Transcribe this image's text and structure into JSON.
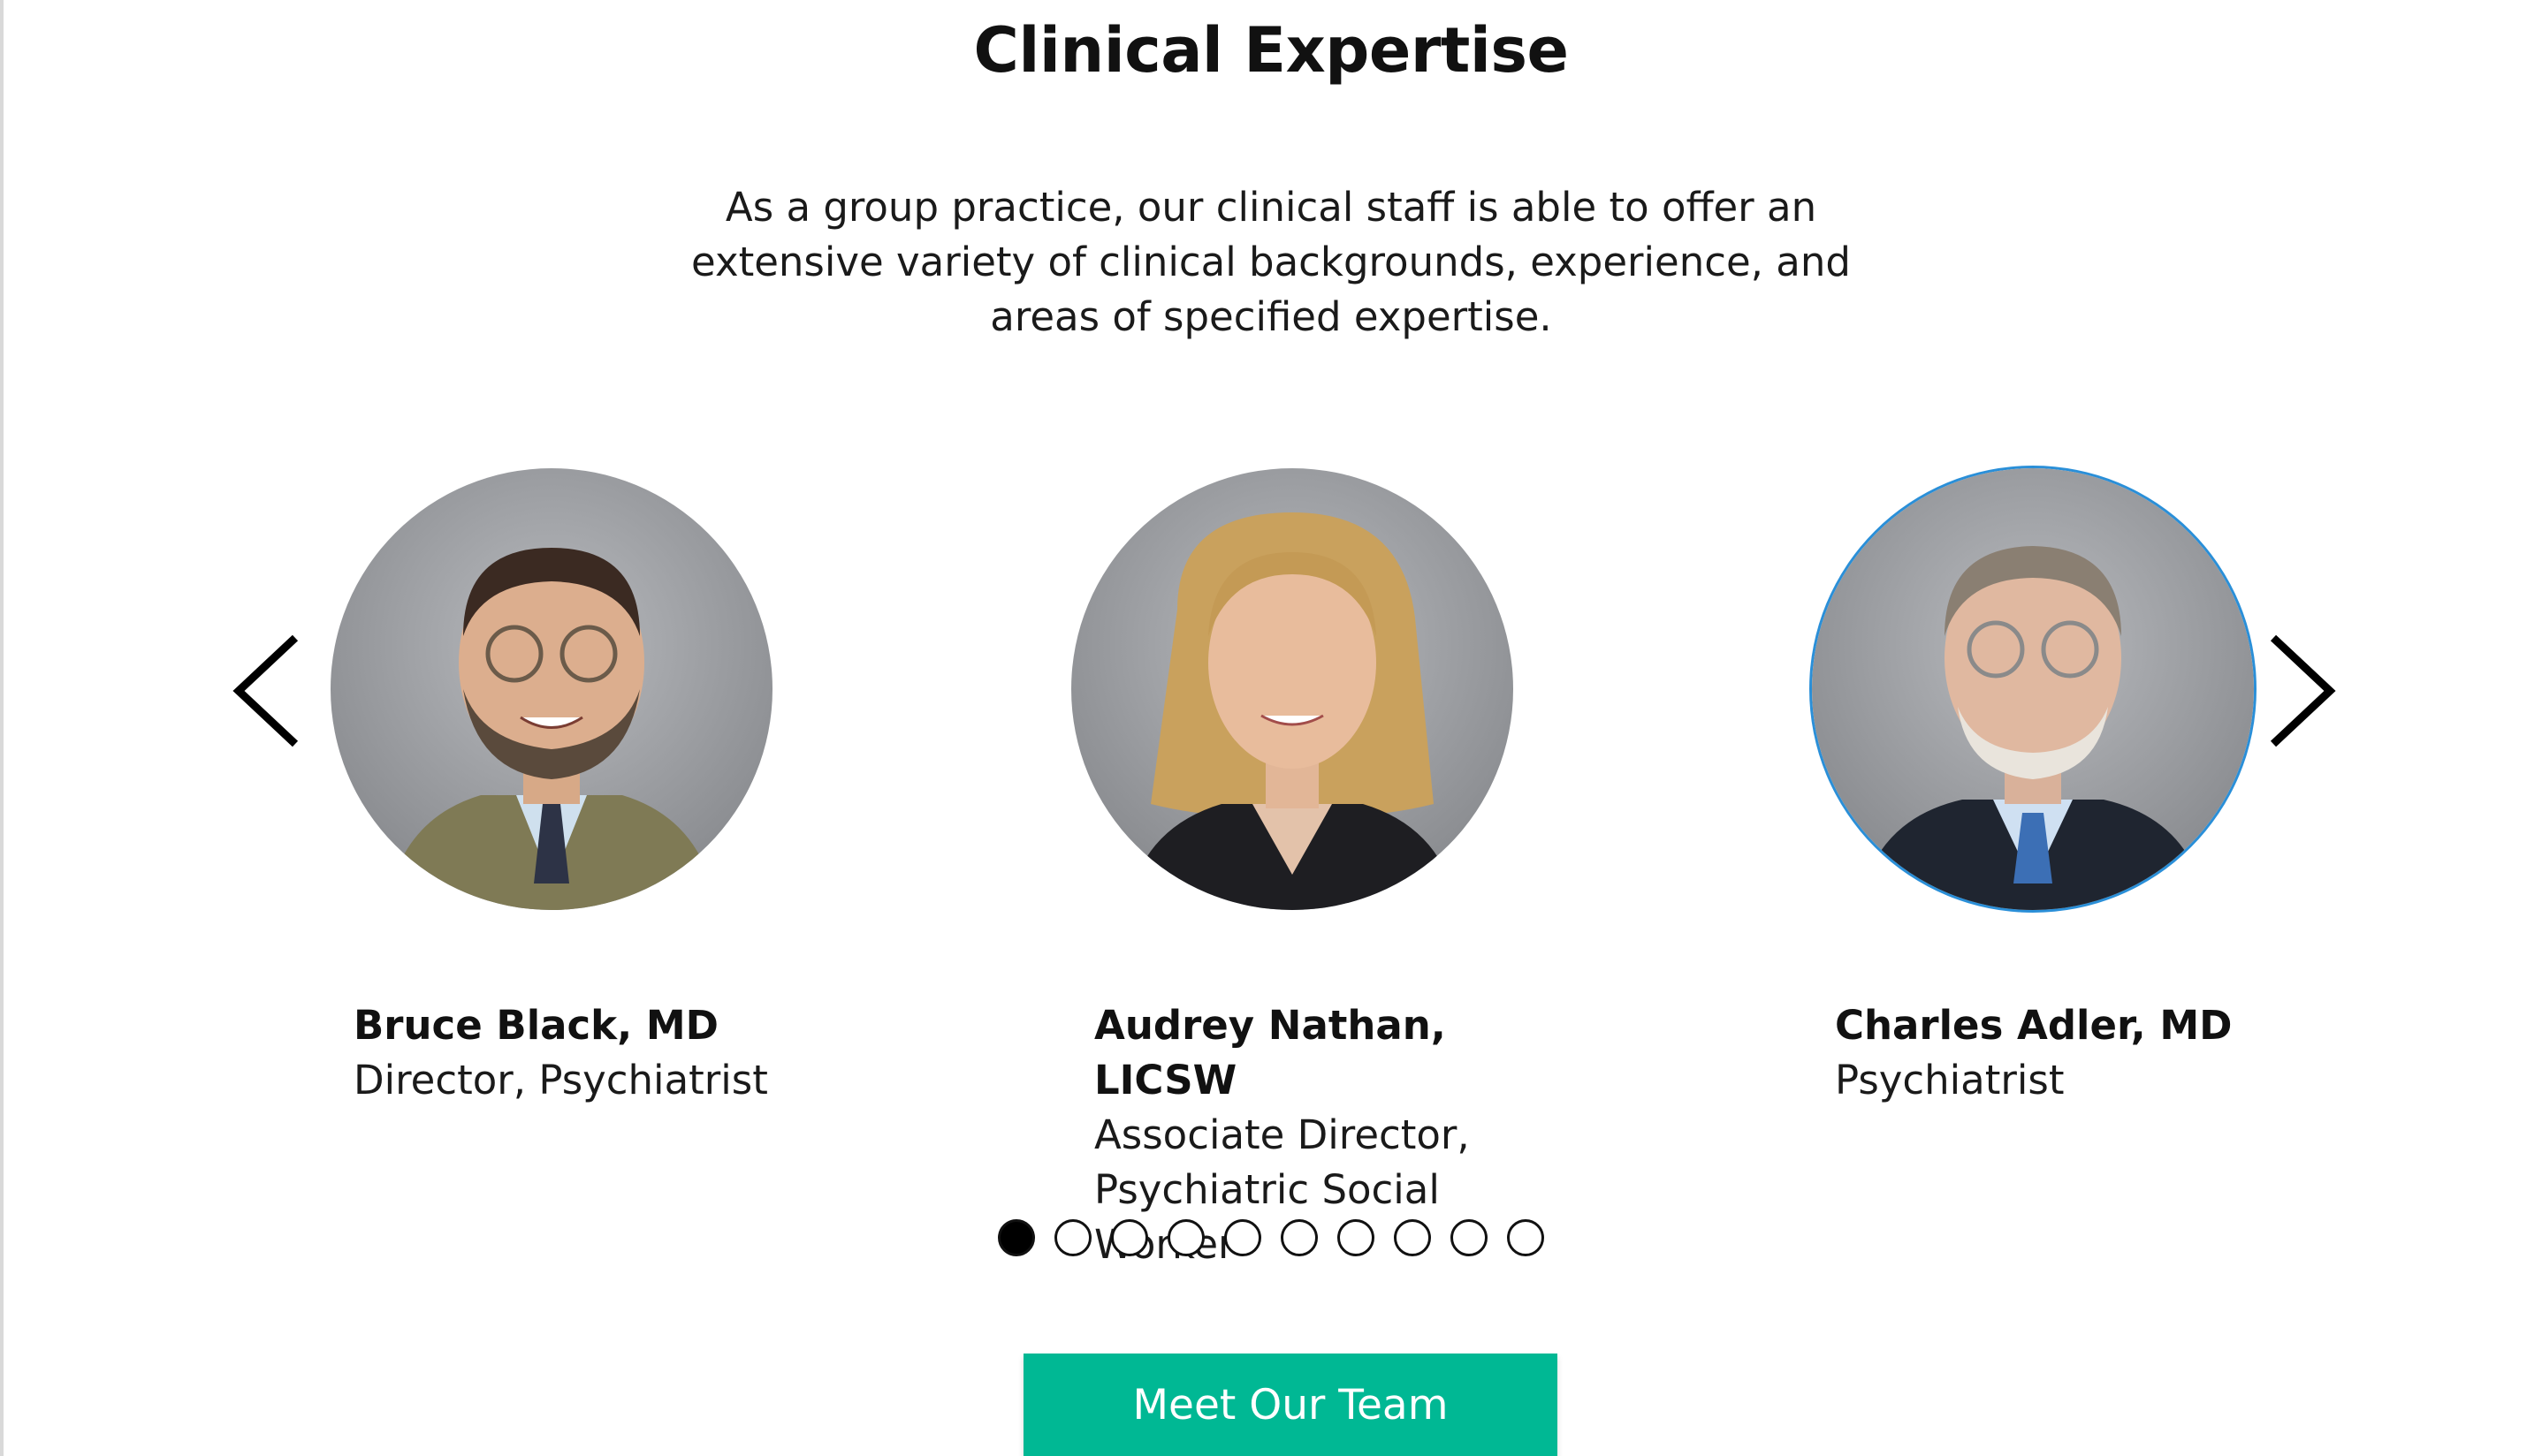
{
  "section": {
    "title": "Clinical Expertise",
    "intro": "As a group practice, our clinical staff is able to offer an extensive variety of clinical backgrounds, experience, and areas of specified expertise."
  },
  "carousel": {
    "prev_icon": "chevron-left-icon",
    "next_icon": "chevron-right-icon",
    "members": [
      {
        "name": "Bruce Black, MD",
        "role_line1": "Director, Psychiatrist",
        "role_line2": ""
      },
      {
        "name": "Audrey Nathan, LICSW",
        "role_line1": "Associate Director,",
        "role_line2": "Psychiatric Social Worker"
      },
      {
        "name": "Charles Adler, MD",
        "role_line1": "Psychiatrist",
        "role_line2": ""
      }
    ],
    "page_count": 10,
    "active_page": 1
  },
  "cta": {
    "label": "Meet Our Team",
    "color": "#00b894"
  }
}
